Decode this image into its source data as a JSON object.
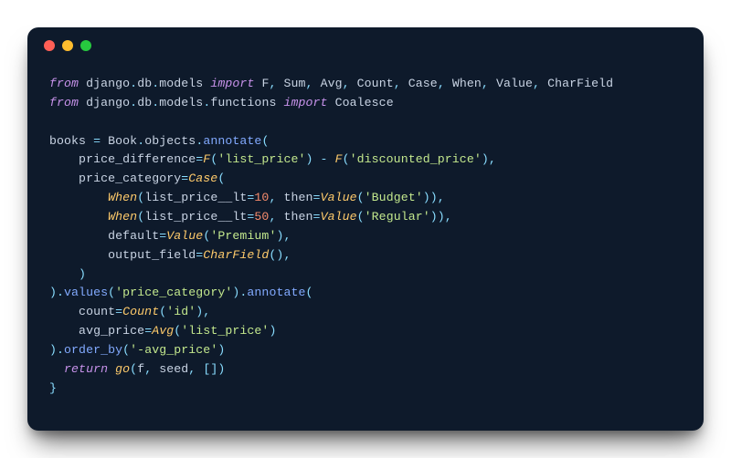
{
  "window": {
    "controls": [
      "close",
      "minimize",
      "zoom"
    ]
  },
  "code": {
    "lines": [
      [
        {
          "t": "from ",
          "c": "kw"
        },
        {
          "t": "django",
          "c": "id"
        },
        {
          "t": ".",
          "c": "op"
        },
        {
          "t": "db",
          "c": "id"
        },
        {
          "t": ".",
          "c": "op"
        },
        {
          "t": "models ",
          "c": "id"
        },
        {
          "t": "import ",
          "c": "kw"
        },
        {
          "t": "F",
          "c": "id"
        },
        {
          "t": ", ",
          "c": "op"
        },
        {
          "t": "Sum",
          "c": "id"
        },
        {
          "t": ", ",
          "c": "op"
        },
        {
          "t": "Avg",
          "c": "id"
        },
        {
          "t": ", ",
          "c": "op"
        },
        {
          "t": "Count",
          "c": "id"
        },
        {
          "t": ", ",
          "c": "op"
        },
        {
          "t": "Case",
          "c": "id"
        },
        {
          "t": ", ",
          "c": "op"
        },
        {
          "t": "When",
          "c": "id"
        },
        {
          "t": ", ",
          "c": "op"
        },
        {
          "t": "Value",
          "c": "id"
        },
        {
          "t": ", ",
          "c": "op"
        },
        {
          "t": "CharField",
          "c": "id"
        }
      ],
      [
        {
          "t": "from ",
          "c": "kw"
        },
        {
          "t": "django",
          "c": "id"
        },
        {
          "t": ".",
          "c": "op"
        },
        {
          "t": "db",
          "c": "id"
        },
        {
          "t": ".",
          "c": "op"
        },
        {
          "t": "models",
          "c": "id"
        },
        {
          "t": ".",
          "c": "op"
        },
        {
          "t": "functions ",
          "c": "id"
        },
        {
          "t": "import ",
          "c": "kw"
        },
        {
          "t": "Coalesce",
          "c": "id"
        }
      ],
      [],
      [
        {
          "t": "books ",
          "c": "id"
        },
        {
          "t": "= ",
          "c": "op"
        },
        {
          "t": "Book",
          "c": "id"
        },
        {
          "t": ".",
          "c": "op"
        },
        {
          "t": "objects",
          "c": "id"
        },
        {
          "t": ".",
          "c": "op"
        },
        {
          "t": "annotate",
          "c": "fn"
        },
        {
          "t": "(",
          "c": "op"
        }
      ],
      [
        {
          "t": "    price_difference",
          "c": "id"
        },
        {
          "t": "=",
          "c": "op"
        },
        {
          "t": "F",
          "c": "cls"
        },
        {
          "t": "(",
          "c": "op"
        },
        {
          "t": "'list_price'",
          "c": "str"
        },
        {
          "t": ") ",
          "c": "op"
        },
        {
          "t": "- ",
          "c": "op"
        },
        {
          "t": "F",
          "c": "cls"
        },
        {
          "t": "(",
          "c": "op"
        },
        {
          "t": "'discounted_price'",
          "c": "str"
        },
        {
          "t": "),",
          "c": "op"
        }
      ],
      [
        {
          "t": "    price_category",
          "c": "id"
        },
        {
          "t": "=",
          "c": "op"
        },
        {
          "t": "Case",
          "c": "cls"
        },
        {
          "t": "(",
          "c": "op"
        }
      ],
      [
        {
          "t": "        ",
          "c": "id"
        },
        {
          "t": "When",
          "c": "cls"
        },
        {
          "t": "(",
          "c": "op"
        },
        {
          "t": "list_price__lt",
          "c": "id"
        },
        {
          "t": "=",
          "c": "op"
        },
        {
          "t": "10",
          "c": "num"
        },
        {
          "t": ", ",
          "c": "op"
        },
        {
          "t": "then",
          "c": "id"
        },
        {
          "t": "=",
          "c": "op"
        },
        {
          "t": "Value",
          "c": "cls"
        },
        {
          "t": "(",
          "c": "op"
        },
        {
          "t": "'Budget'",
          "c": "str"
        },
        {
          "t": ")),",
          "c": "op"
        }
      ],
      [
        {
          "t": "        ",
          "c": "id"
        },
        {
          "t": "When",
          "c": "cls"
        },
        {
          "t": "(",
          "c": "op"
        },
        {
          "t": "list_price__lt",
          "c": "id"
        },
        {
          "t": "=",
          "c": "op"
        },
        {
          "t": "50",
          "c": "num"
        },
        {
          "t": ", ",
          "c": "op"
        },
        {
          "t": "then",
          "c": "id"
        },
        {
          "t": "=",
          "c": "op"
        },
        {
          "t": "Value",
          "c": "cls"
        },
        {
          "t": "(",
          "c": "op"
        },
        {
          "t": "'Regular'",
          "c": "str"
        },
        {
          "t": ")),",
          "c": "op"
        }
      ],
      [
        {
          "t": "        default",
          "c": "id"
        },
        {
          "t": "=",
          "c": "op"
        },
        {
          "t": "Value",
          "c": "cls"
        },
        {
          "t": "(",
          "c": "op"
        },
        {
          "t": "'Premium'",
          "c": "str"
        },
        {
          "t": "),",
          "c": "op"
        }
      ],
      [
        {
          "t": "        output_field",
          "c": "id"
        },
        {
          "t": "=",
          "c": "op"
        },
        {
          "t": "CharField",
          "c": "cls"
        },
        {
          "t": "(),",
          "c": "op"
        }
      ],
      [
        {
          "t": "    )",
          "c": "op"
        }
      ],
      [
        {
          "t": ")",
          "c": "op"
        },
        {
          "t": ".",
          "c": "op"
        },
        {
          "t": "values",
          "c": "fn"
        },
        {
          "t": "(",
          "c": "op"
        },
        {
          "t": "'price_category'",
          "c": "str"
        },
        {
          "t": ")",
          "c": "op"
        },
        {
          "t": ".",
          "c": "op"
        },
        {
          "t": "annotate",
          "c": "fn"
        },
        {
          "t": "(",
          "c": "op"
        }
      ],
      [
        {
          "t": "    count",
          "c": "id"
        },
        {
          "t": "=",
          "c": "op"
        },
        {
          "t": "Count",
          "c": "cls"
        },
        {
          "t": "(",
          "c": "op"
        },
        {
          "t": "'id'",
          "c": "str"
        },
        {
          "t": "),",
          "c": "op"
        }
      ],
      [
        {
          "t": "    avg_price",
          "c": "id"
        },
        {
          "t": "=",
          "c": "op"
        },
        {
          "t": "Avg",
          "c": "cls"
        },
        {
          "t": "(",
          "c": "op"
        },
        {
          "t": "'list_price'",
          "c": "str"
        },
        {
          "t": ")",
          "c": "op"
        }
      ],
      [
        {
          "t": ")",
          "c": "op"
        },
        {
          "t": ".",
          "c": "op"
        },
        {
          "t": "order_by",
          "c": "fn"
        },
        {
          "t": "(",
          "c": "op"
        },
        {
          "t": "'-avg_price'",
          "c": "str"
        },
        {
          "t": ")",
          "c": "op"
        }
      ],
      [
        {
          "t": "  ",
          "c": "id"
        },
        {
          "t": "return ",
          "c": "kw"
        },
        {
          "t": "go",
          "c": "cls"
        },
        {
          "t": "(",
          "c": "op"
        },
        {
          "t": "f",
          "c": "id"
        },
        {
          "t": ", ",
          "c": "op"
        },
        {
          "t": "seed",
          "c": "id"
        },
        {
          "t": ", ",
          "c": "op"
        },
        {
          "t": "[",
          "c": "op"
        },
        {
          "t": "]",
          "c": "op"
        },
        {
          "t": ")",
          "c": "op"
        }
      ],
      [
        {
          "t": "}",
          "c": "op"
        }
      ]
    ]
  }
}
